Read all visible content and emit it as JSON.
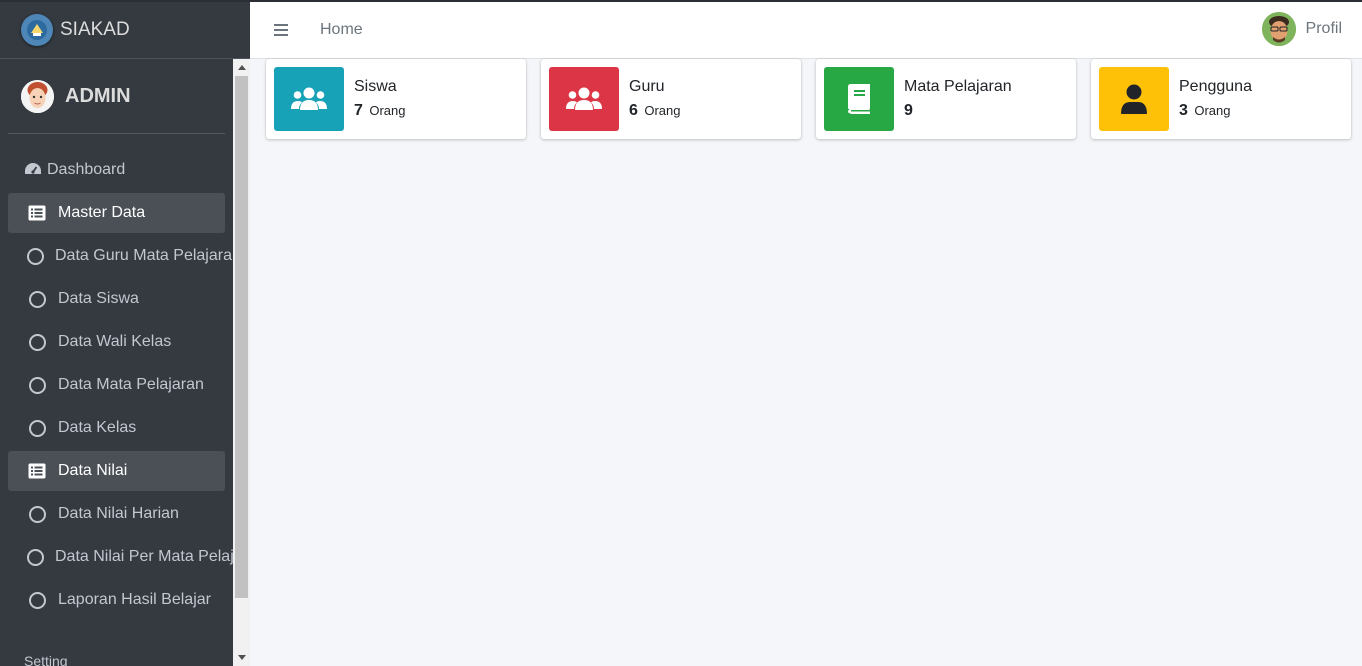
{
  "brand": {
    "title": "SIAKAD"
  },
  "user": {
    "name": "ADMIN"
  },
  "topbar": {
    "home": "Home",
    "profile": "Profil"
  },
  "nav": [
    {
      "label": "Dashboard"
    },
    {
      "label": "Master Data"
    },
    {
      "label": "Data Guru Mata Pelajaran"
    },
    {
      "label": "Data Siswa"
    },
    {
      "label": "Data Wali Kelas"
    },
    {
      "label": "Data Mata Pelajaran"
    },
    {
      "label": "Data Kelas"
    },
    {
      "label": "Data Nilai"
    },
    {
      "label": "Data Nilai Harian"
    },
    {
      "label": "Data Nilai Per Mata Pelajaran"
    },
    {
      "label": "Laporan Hasil Belajar"
    }
  ],
  "nav_section": "Setting",
  "cards": [
    {
      "title": "Siswa",
      "value": "7",
      "unit": "Orang",
      "color": "#17a2b8",
      "icon": "users-icon"
    },
    {
      "title": "Guru",
      "value": "6",
      "unit": "Orang",
      "color": "#dc3545",
      "icon": "users-icon"
    },
    {
      "title": "Mata Pelajaran",
      "value": "9",
      "unit": "",
      "color": "#28a745",
      "icon": "book-icon"
    },
    {
      "title": "Pengguna",
      "value": "3",
      "unit": "Orang",
      "color": "#ffc107",
      "icon": "user-icon"
    }
  ]
}
